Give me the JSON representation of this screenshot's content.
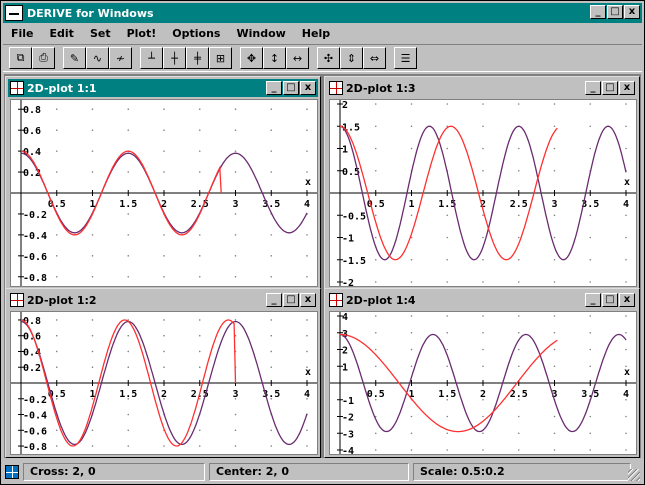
{
  "app": {
    "title": "DERIVE for Windows",
    "caption_buttons": [
      "_",
      "□",
      "x"
    ]
  },
  "menu": [
    {
      "label": "File"
    },
    {
      "label": "Edit"
    },
    {
      "label": "Set"
    },
    {
      "label": "Plot!"
    },
    {
      "label": "Options"
    },
    {
      "label": "Window"
    },
    {
      "label": "Help"
    }
  ],
  "toolbar": {
    "groups": [
      [
        "copy-icon",
        "print-icon"
      ],
      [
        "draw-pen-icon",
        "plot-curve-icon",
        "erase-curve-icon"
      ],
      [
        "axes-icon",
        "crosshair-icon",
        "grid-icon",
        "center-icon"
      ],
      [
        "zoom-in-both-icon",
        "zoom-in-vertical-icon",
        "zoom-in-horizontal-icon"
      ],
      [
        "zoom-out-both-icon",
        "zoom-out-vertical-icon",
        "zoom-out-horizontal-icon"
      ],
      [
        "algebra-window-icon"
      ]
    ]
  },
  "plots": [
    {
      "id": "1-1",
      "title": "2D-plot 1:1",
      "active": true,
      "x_ticks": [
        "0.5",
        "1",
        "1.5",
        "2",
        "2.5",
        "3",
        "3.5",
        "4"
      ],
      "y_ticks": [
        "0.8",
        "0.6",
        "0.4",
        "0.2",
        "-0.2",
        "-0.4",
        "-0.6",
        "-0.8"
      ],
      "x_axis_label": "x",
      "xlim": [
        0,
        4
      ],
      "ylim": [
        -0.85,
        0.85
      ]
    },
    {
      "id": "1-3",
      "title": "2D-plot 1:3",
      "active": false,
      "x_ticks": [
        "0.5",
        "1",
        "1.5",
        "2",
        "2.5",
        "3",
        "3.5",
        "4"
      ],
      "y_ticks": [
        "2",
        "1.5",
        "1",
        "0.5",
        "-0.5",
        "-1",
        "-1.5",
        "-2"
      ],
      "x_axis_label": "x",
      "xlim": [
        0,
        4
      ],
      "ylim": [
        -2,
        2
      ]
    },
    {
      "id": "1-2",
      "title": "2D-plot 1:2",
      "active": false,
      "x_ticks": [
        "0.5",
        "1",
        "1.5",
        "2",
        "2.5",
        "3",
        "3.5",
        "4"
      ],
      "y_ticks": [
        "0.8",
        "0.6",
        "0.4",
        "0.2",
        "-0.2",
        "-0.4",
        "-0.6",
        "-0.8"
      ],
      "x_axis_label": "x",
      "xlim": [
        0,
        4
      ],
      "ylim": [
        -0.85,
        0.85
      ]
    },
    {
      "id": "1-4",
      "title": "2D-plot 1:4",
      "active": false,
      "x_ticks": [
        "0.5",
        "1",
        "1.5",
        "2",
        "2.5",
        "3",
        "3.5",
        "4"
      ],
      "y_ticks": [
        "4",
        "3",
        "2",
        "1",
        "-1",
        "-2",
        "-3",
        "-4"
      ],
      "x_axis_label": "x",
      "xlim": [
        0,
        4
      ],
      "ylim": [
        -4,
        4
      ]
    }
  ],
  "colors": {
    "purple_curve": "#6a2c70",
    "red_curve": "#ff3030",
    "title_active": "#008080"
  },
  "status": {
    "cross": "Cross: 2, 0",
    "center": "Center: 2, 0",
    "scale": "Scale: 0.5:0.2"
  }
}
